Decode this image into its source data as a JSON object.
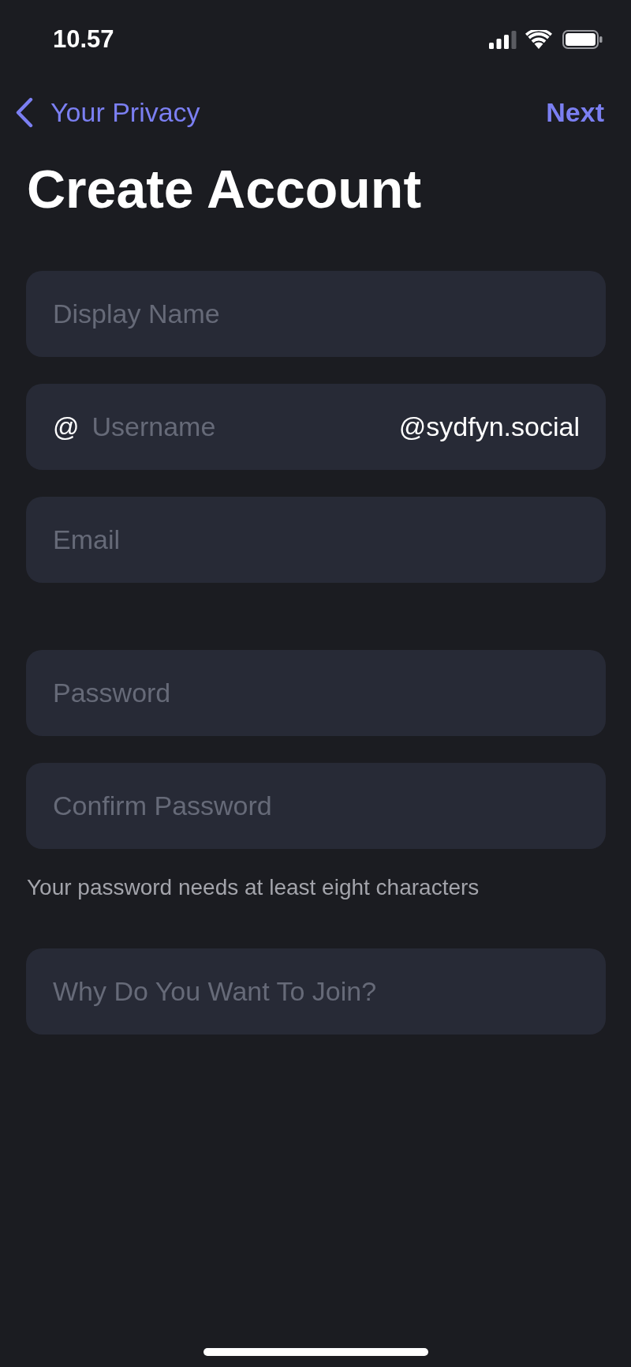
{
  "status_bar": {
    "time": "10.57"
  },
  "nav_bar": {
    "back": "Your Privacy",
    "action": "Next"
  },
  "title": "Create Account",
  "sections": [
    {
      "fields": [
        {
          "kind": "text",
          "placeholder": "Display Name"
        },
        {
          "kind": "username",
          "prefix": "@",
          "placeholder": "Username",
          "suffix": "@sydfyn.social"
        },
        {
          "kind": "text",
          "placeholder": "Email"
        }
      ]
    },
    {
      "fields": [
        {
          "kind": "text",
          "placeholder": "Password"
        },
        {
          "kind": "text",
          "placeholder": "Confirm Password"
        }
      ],
      "note": "Your password needs at least eight characters"
    },
    {
      "fields": [
        {
          "kind": "text",
          "placeholder": "Why Do You Want To Join?"
        }
      ]
    }
  ]
}
